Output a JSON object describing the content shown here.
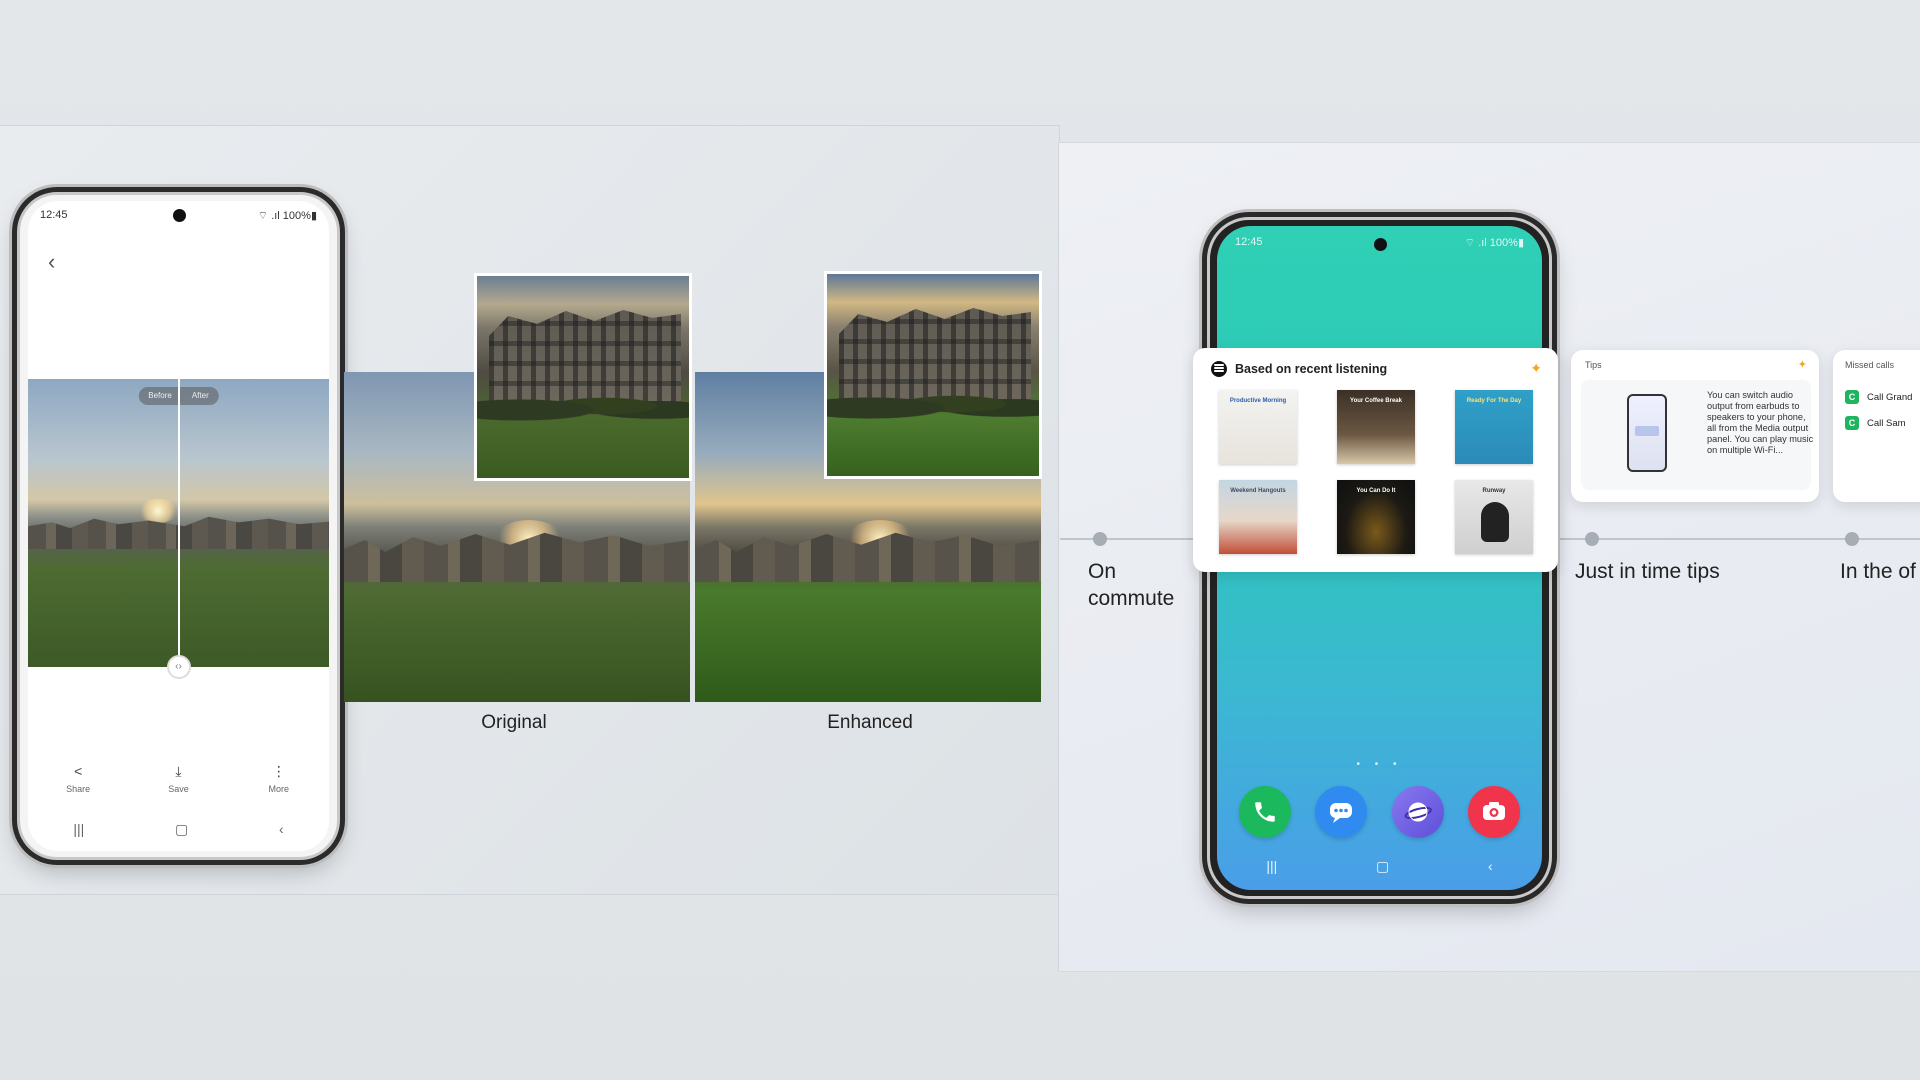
{
  "gallery_phone": {
    "status_time": "12:45",
    "status_right": "⌔ .ıl 100%▮",
    "before_label": "Before",
    "after_label": "After",
    "actions": [
      {
        "icon": "share-icon",
        "glyph": "<",
        "label": "Share"
      },
      {
        "icon": "download-icon",
        "glyph": "⤓",
        "label": "Save"
      },
      {
        "icon": "more-vertical-icon",
        "glyph": "⋮",
        "label": "More"
      }
    ]
  },
  "comparison": {
    "original_label": "Original",
    "enhanced_label": "Enhanced"
  },
  "home_phone": {
    "status_time": "12:45",
    "status_right": "⌔ .ıl 100%▮",
    "page_dots": "• • •"
  },
  "listening_card": {
    "title": "Based on recent listening",
    "albums": [
      {
        "title": "Productive Morning"
      },
      {
        "title": "Your Coffee Break"
      },
      {
        "title": "Ready For The Day"
      },
      {
        "title": "Weekend Hangouts"
      },
      {
        "title": "You Can Do It"
      },
      {
        "title": "Runway"
      }
    ]
  },
  "tips_card": {
    "header": "Tips",
    "text": "You can switch audio output from earbuds to speakers to your phone, all from the Media output panel. You can play music on multiple Wi-Fi..."
  },
  "missed_calls_card": {
    "header": "Missed calls",
    "calls": [
      "Call Grand",
      "Call Sam"
    ]
  },
  "timeline": {
    "labels": [
      "On\ncommute",
      "Just in time tips",
      "In the of"
    ]
  },
  "colors": {
    "accent_sparkle": "#f7a31c",
    "phone_app": "#1cb85e",
    "messages_app": "#2f8bf0",
    "camera_app": "#f0344c",
    "home_gradient_top": "#2fd0b5",
    "home_gradient_bottom": "#4a9ee8"
  }
}
